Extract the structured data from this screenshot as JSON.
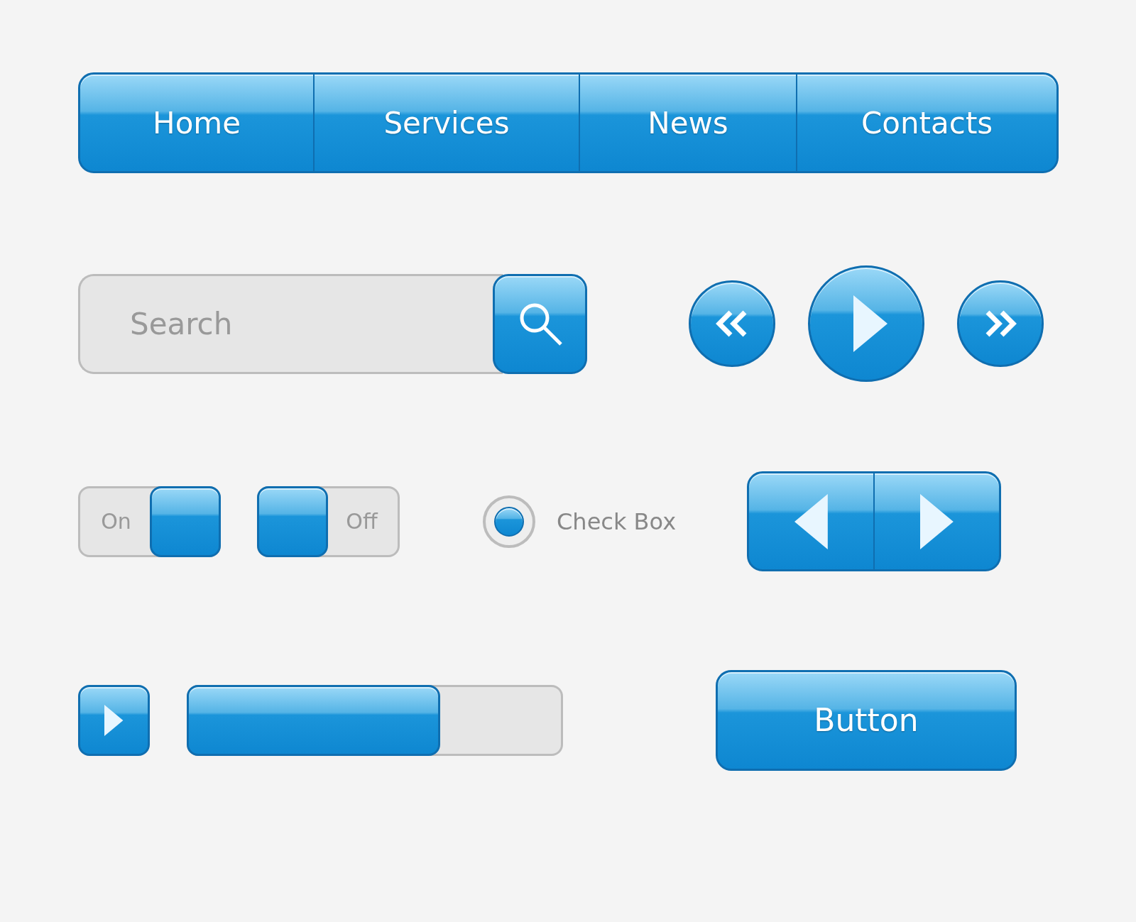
{
  "nav": {
    "items": [
      {
        "label": "Home"
      },
      {
        "label": "Services"
      },
      {
        "label": "News"
      },
      {
        "label": "Contacts"
      }
    ]
  },
  "search": {
    "placeholder": "Search"
  },
  "media": {
    "buttons": [
      {
        "kind": "rewind"
      },
      {
        "kind": "play"
      },
      {
        "kind": "forward"
      }
    ]
  },
  "toggles": [
    {
      "label": "On",
      "on": true
    },
    {
      "label": "Off",
      "on": false
    }
  ],
  "check_box": {
    "label": "Check Box",
    "checked": true
  },
  "progress": {
    "level": 0.67
  },
  "button": {
    "label": "Button"
  }
}
